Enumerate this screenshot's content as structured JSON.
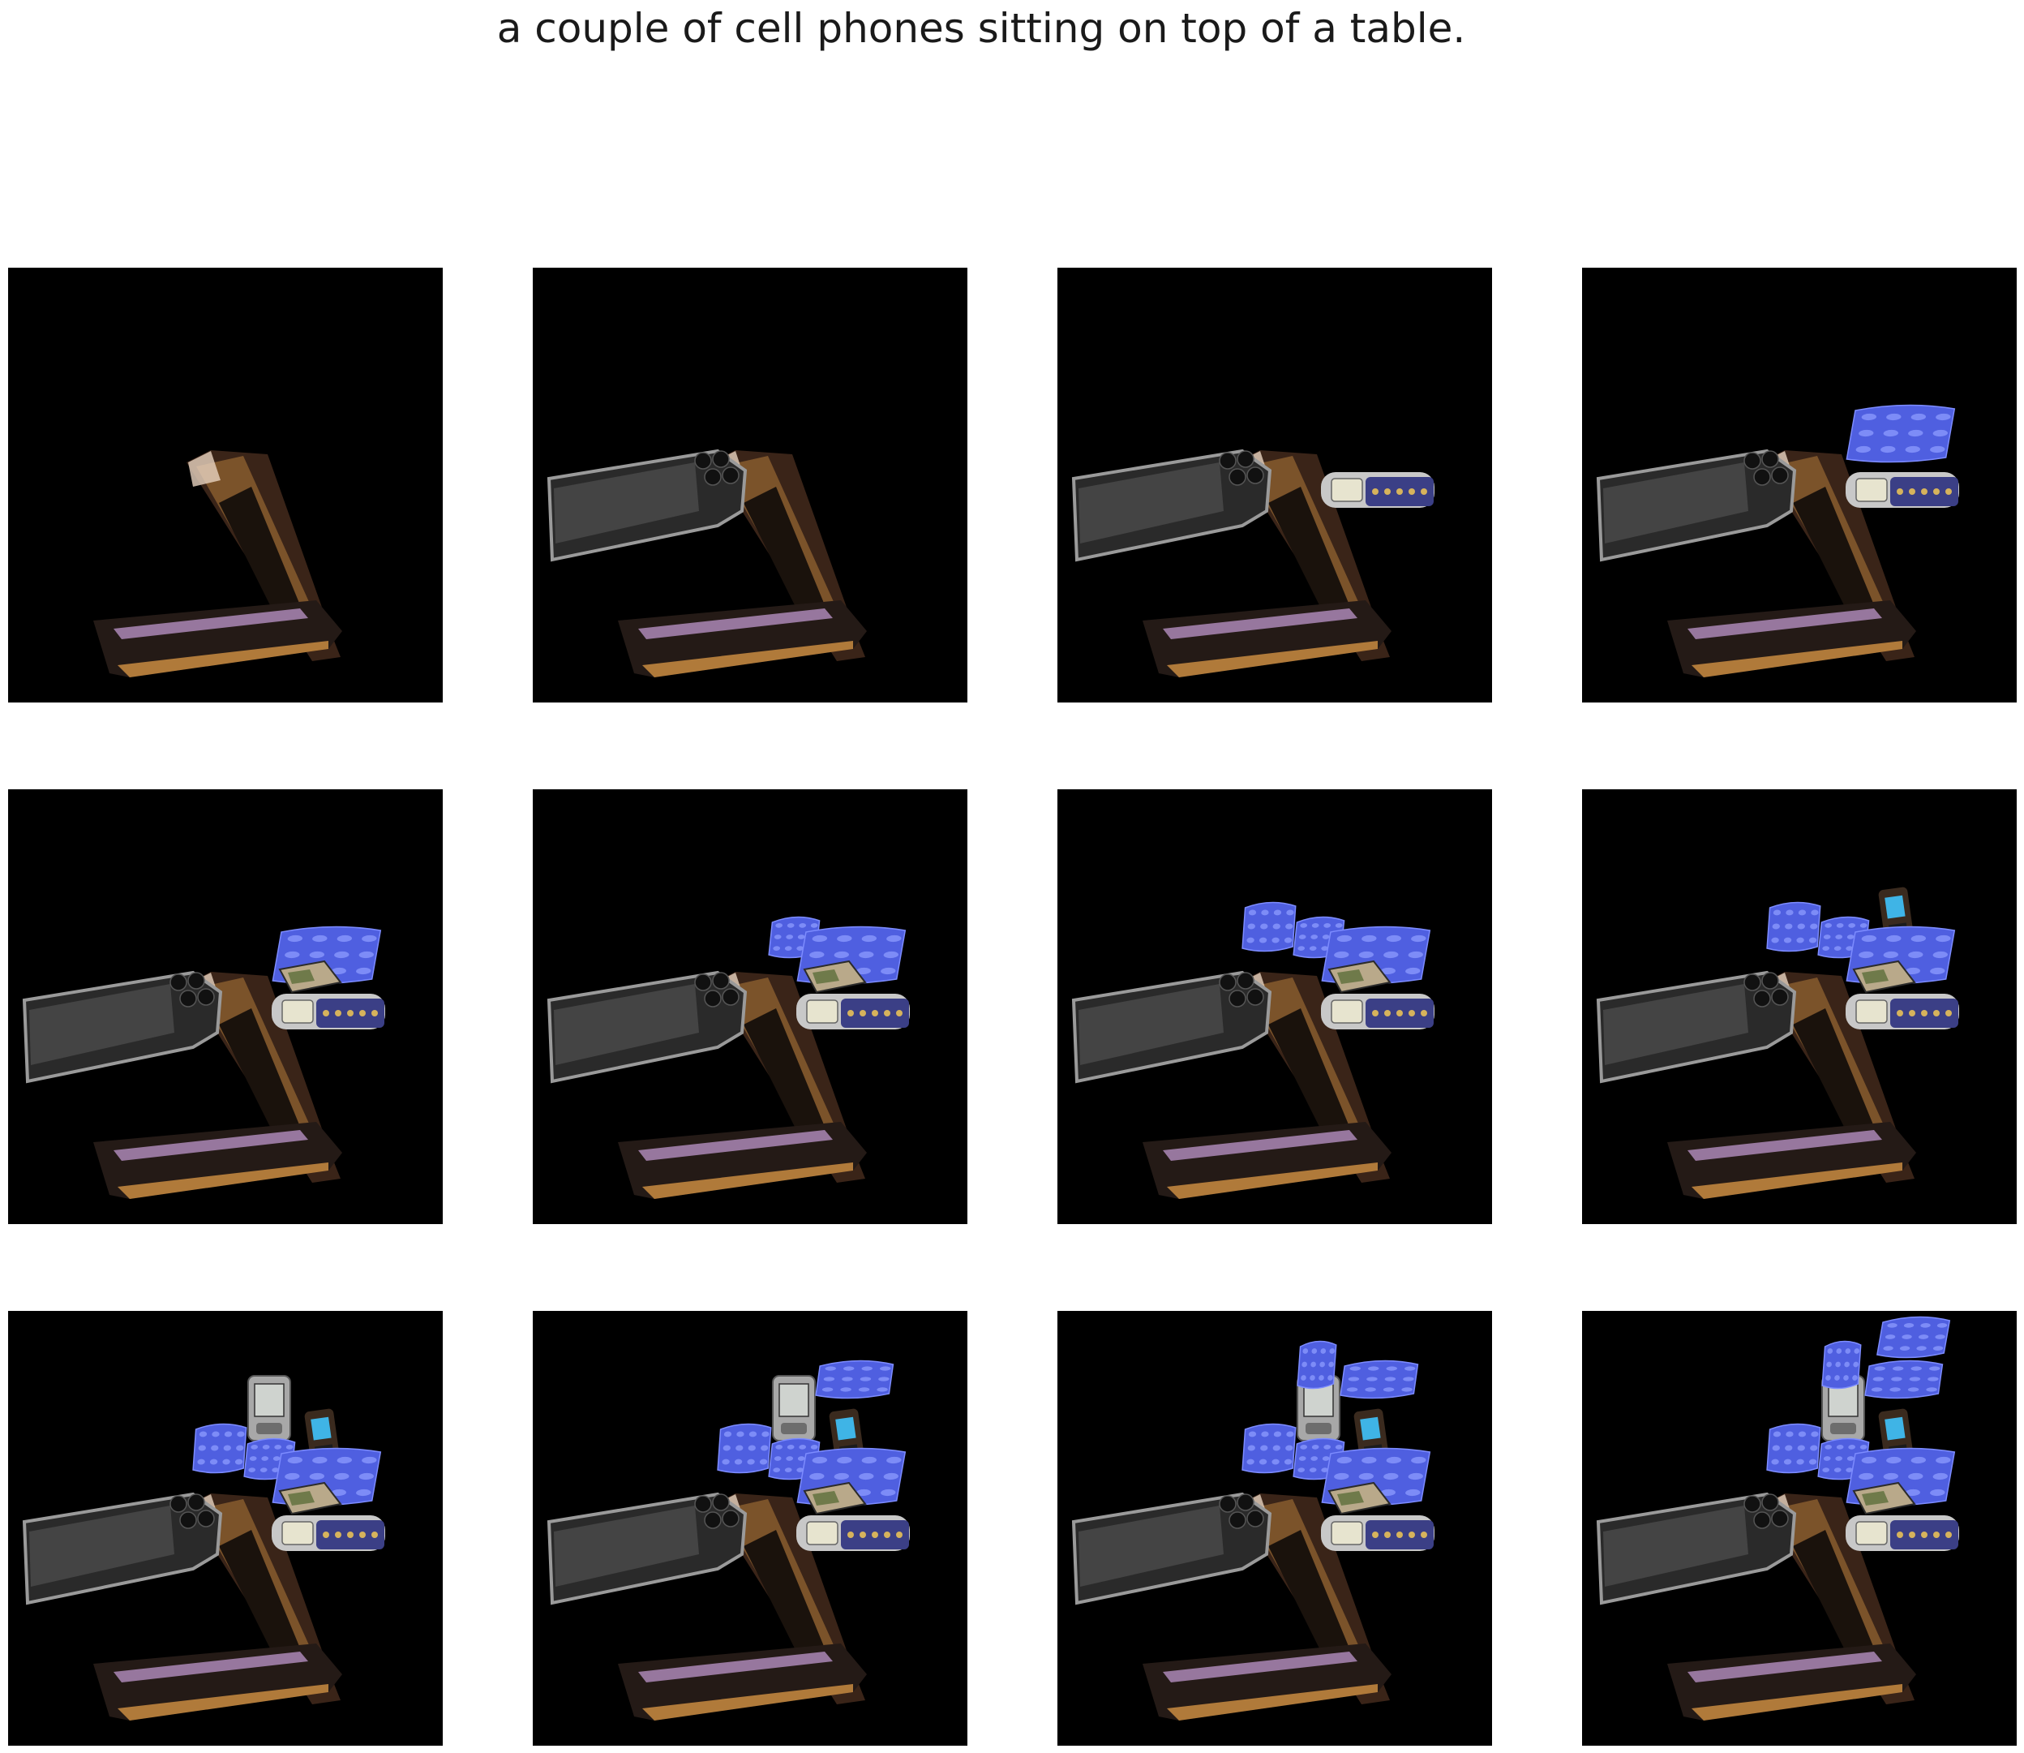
{
  "caption": "a couple of cell phones sitting on top of a table.",
  "colors": {
    "background": "#000000",
    "keypad_blue": "#4f5fe0",
    "psp_body": "#2a2a2a",
    "flip_bronze": "#b07a3a",
    "candybar_silver": "#c8c8c8",
    "pda_grey": "#a8a8a8"
  },
  "panels": [
    {
      "step": 1,
      "objects": [
        "flip-phone"
      ]
    },
    {
      "step": 2,
      "objects": [
        "flip-phone",
        "psp"
      ]
    },
    {
      "step": 3,
      "objects": [
        "flip-phone",
        "psp",
        "candybar-phone"
      ]
    },
    {
      "step": 4,
      "objects": [
        "flip-phone",
        "psp",
        "candybar-phone",
        "keypad-a"
      ]
    },
    {
      "step": 5,
      "objects": [
        "flip-phone",
        "psp",
        "candybar-phone",
        "keypad-a",
        "tan-phone"
      ]
    },
    {
      "step": 6,
      "objects": [
        "flip-phone",
        "psp",
        "candybar-phone",
        "keypad-a",
        "tan-phone",
        "keypad-b"
      ]
    },
    {
      "step": 7,
      "objects": [
        "flip-phone",
        "psp",
        "candybar-phone",
        "keypad-a",
        "tan-phone",
        "keypad-b",
        "keypad-c"
      ]
    },
    {
      "step": 8,
      "objects": [
        "flip-phone",
        "psp",
        "candybar-phone",
        "keypad-a",
        "tan-phone",
        "keypad-b",
        "keypad-c",
        "color-phone"
      ]
    },
    {
      "step": 9,
      "objects": [
        "flip-phone",
        "psp",
        "candybar-phone",
        "keypad-a",
        "tan-phone",
        "keypad-b",
        "keypad-c",
        "color-phone",
        "pda"
      ]
    },
    {
      "step": 10,
      "objects": [
        "flip-phone",
        "psp",
        "candybar-phone",
        "keypad-a",
        "tan-phone",
        "keypad-b",
        "keypad-c",
        "color-phone",
        "pda",
        "keypad-d"
      ]
    },
    {
      "step": 11,
      "objects": [
        "flip-phone",
        "psp",
        "candybar-phone",
        "keypad-a",
        "tan-phone",
        "keypad-b",
        "keypad-c",
        "color-phone",
        "pda",
        "keypad-d",
        "keypad-e"
      ]
    },
    {
      "step": 12,
      "objects": [
        "flip-phone",
        "psp",
        "candybar-phone",
        "keypad-a",
        "tan-phone",
        "keypad-b",
        "keypad-c",
        "color-phone",
        "pda",
        "keypad-d",
        "keypad-e",
        "keypad-f"
      ]
    }
  ]
}
